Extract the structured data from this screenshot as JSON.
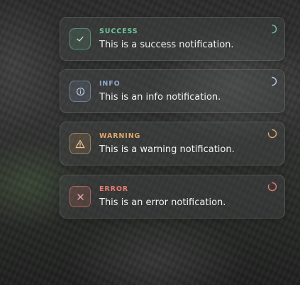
{
  "notifications": [
    {
      "type": "success",
      "title": "SUCCESS",
      "message": "This is a success notification.",
      "icon": "check-icon",
      "color": "#6fc79a"
    },
    {
      "type": "info",
      "title": "INFO",
      "message": "This is an info notification.",
      "icon": "info-icon",
      "color": "#8fa8cf"
    },
    {
      "type": "warning",
      "title": "WARNING",
      "message": "This is a warning notification.",
      "icon": "warning-icon",
      "color": "#e0a86a"
    },
    {
      "type": "error",
      "title": "ERROR",
      "message": "This is an error notification.",
      "icon": "close-icon",
      "color": "#ea7a72"
    }
  ]
}
